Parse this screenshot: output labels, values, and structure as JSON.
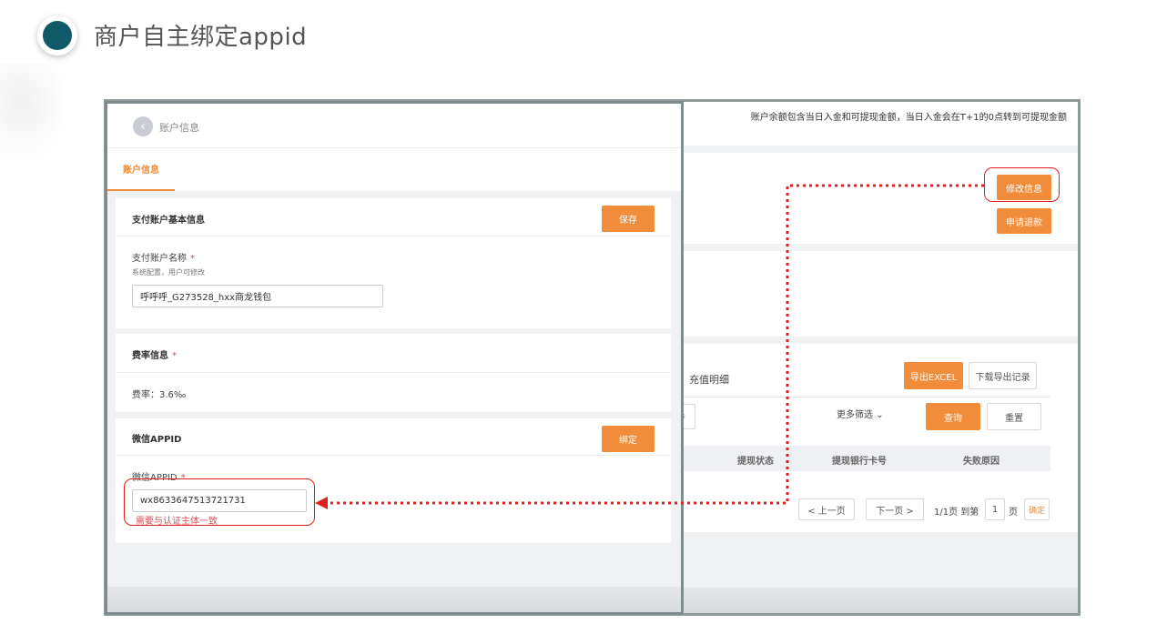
{
  "slide": {
    "title": "商户自主绑定appid"
  },
  "background_screen": {
    "notice": "账户余额包含当日入金和可提现金额，当日入金会在T+1的0点转到可提现金额",
    "modify_button": "修改信息",
    "refund_button": "申请退款",
    "recharge_tab": "充值明细",
    "export_button": "导出EXCEL",
    "download_button": "下载导出记录",
    "partial_filter": "步",
    "more_filter": "更多筛选",
    "query_button": "查询",
    "reset_button": "重置",
    "table_headers": [
      "提现状态",
      "提现银行卡号",
      "失败原因"
    ],
    "pagination": {
      "prev": "< 上一页",
      "next": "下一页 >",
      "info": "1/1页 到第",
      "page_value": "1",
      "page_unit": "页",
      "confirm": "确定"
    }
  },
  "panel": {
    "header_title": "账户信息",
    "tab": "账户信息",
    "basic_section": {
      "title": "支付账户基本信息",
      "save_button": "保存",
      "name_label": "支付账户名称",
      "name_hint": "系统配置，用户可修改",
      "name_value": "呼呼呼_G273528_hxx商龙钱包"
    },
    "rate_section": {
      "title": "费率信息",
      "rate_text": "费率：3.6‰"
    },
    "appid_section": {
      "title": "微信APPID",
      "bind_button": "绑定",
      "appid_label": "微信APPID",
      "appid_value": "wx8633647513721731",
      "appid_error": "需要与认证主体一致"
    },
    "required_mark": "*"
  },
  "colors": {
    "accent": "#f08c3a",
    "annotation_red": "#e02020",
    "bullet": "#0f5a66"
  }
}
